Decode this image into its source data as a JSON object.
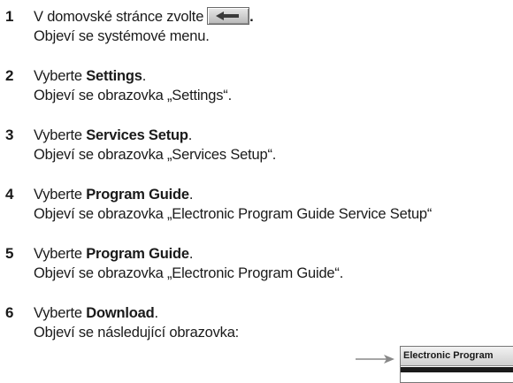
{
  "steps": [
    {
      "number": "1",
      "line1_text": "V domovské stránce zvolte",
      "line1_suffix": ".",
      "line2": "Objeví se systémové menu."
    },
    {
      "number": "2",
      "line1_prefix": "Vyberte ",
      "line1_bold": "Settings",
      "line1_suffix": ".",
      "line2": "Objeví se obrazovka „Settings“."
    },
    {
      "number": "3",
      "line1_prefix": "Vyberte ",
      "line1_bold": "Services Setup",
      "line1_suffix": ".",
      "line2": "Objeví se obrazovka „Services Setup“."
    },
    {
      "number": "4",
      "line1_prefix": "Vyberte ",
      "line1_bold": "Program Guide",
      "line1_suffix": ".",
      "line2": "Objeví se obrazovka „Electronic Program Guide Service Setup“"
    },
    {
      "number": "5",
      "line1_prefix": "Vyberte ",
      "line1_bold": "Program Guide",
      "line1_suffix": ".",
      "line2": "Objeví se obrazovka „Electronic Program Guide“."
    },
    {
      "number": "6",
      "line1_prefix": "Vyberte ",
      "line1_bold": "Download",
      "line1_suffix": ".",
      "line2": "Objeví se následující obrazovka:"
    }
  ],
  "back_button_icon": "back-arrow-icon",
  "preview_window": {
    "title": "Electronic Program"
  },
  "colors": {
    "text": "#1a1a1a",
    "button_face": "#c8c8c8",
    "arrow": "#888888"
  }
}
